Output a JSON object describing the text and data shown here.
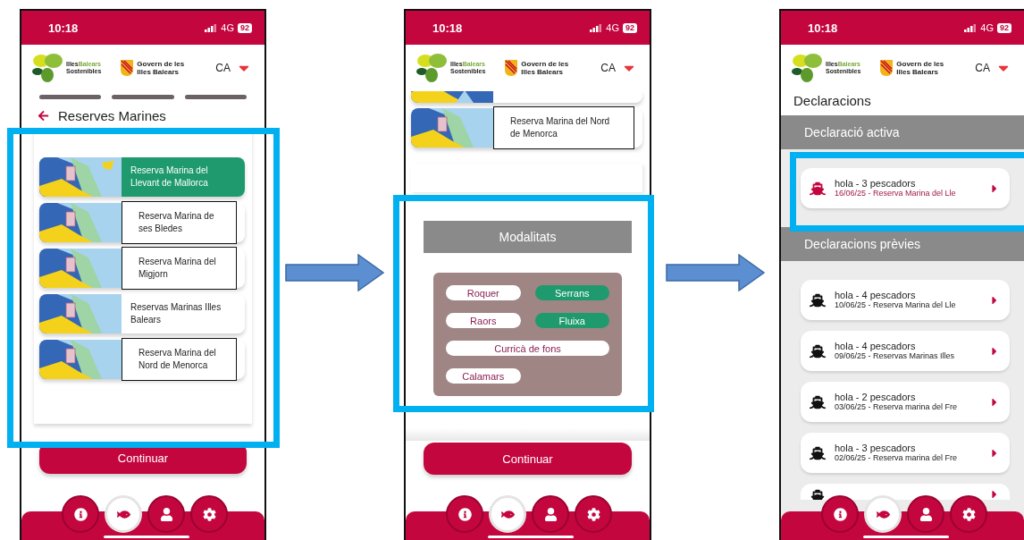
{
  "screens": [
    {
      "kind": "reserves",
      "time": "10:18",
      "network": "4G",
      "battery": "92",
      "brand": [
        "Illes",
        "Balears"
      ],
      "brand_sub": "Sostenibles",
      "govern": [
        "Govern de les",
        "Illes Balears"
      ],
      "language": "CA",
      "progress": [
        {
          "done": false
        },
        {
          "done": false
        },
        {
          "done": false
        }
      ],
      "title": "Reserves Marines",
      "reserves": [
        {
          "name": "Reserva Marina del Llevant de Mallorca",
          "selected": true,
          "outlined": false
        },
        {
          "name": "Reserva Marina de ses Bledes",
          "selected": false,
          "outlined": true
        },
        {
          "name": "Reserva Marina del Migjorn",
          "selected": false,
          "outlined": true
        },
        {
          "name": "Reservas Marinas Illes Balears",
          "selected": false,
          "outlined": false
        },
        {
          "name": "Reserva Marina del Nord de Menorca",
          "selected": false,
          "outlined": true
        }
      ],
      "button": "Continuar",
      "nav": [
        {
          "kind": "info",
          "selected": false
        },
        {
          "kind": "fish",
          "selected": true
        },
        {
          "kind": "user",
          "selected": false
        },
        {
          "kind": "settings",
          "selected": false
        }
      ]
    },
    {
      "kind": "modalitats",
      "time": "10:18",
      "network": "4G",
      "battery": "92",
      "brand": [
        "Illes",
        "Balears"
      ],
      "brand_sub": "Sostenibles",
      "govern": [
        "Govern de les",
        "Illes Balears"
      ],
      "language": "CA",
      "scrolled_card_above": true,
      "reserves": [
        {
          "name": "Reserva Marina del Nord de Menorca",
          "selected": false,
          "outlined": true
        }
      ],
      "blank_card": true,
      "modalitats_title": "Modalitats",
      "chips": [
        {
          "label": "Roquer",
          "selected": false,
          "wide": false
        },
        {
          "label": "Serrans",
          "selected": true,
          "wide": false
        },
        {
          "label": "Raors",
          "selected": false,
          "wide": false
        },
        {
          "label": "Fluixa",
          "selected": true,
          "wide": false
        },
        {
          "label": "Curricà de fons",
          "selected": false,
          "wide": true
        },
        {
          "label": "Calamars",
          "selected": false,
          "wide": false
        }
      ],
      "button": "Continuar",
      "nav": [
        {
          "kind": "info",
          "selected": false
        },
        {
          "kind": "fish",
          "selected": true
        },
        {
          "kind": "user",
          "selected": false
        },
        {
          "kind": "settings",
          "selected": false
        }
      ]
    },
    {
      "kind": "declaracions",
      "time": "10:18",
      "network": "4G",
      "battery": "92",
      "brand": [
        "Illes",
        "Balears"
      ],
      "brand_sub": "Sostenibles",
      "govern": [
        "Govern de les",
        "Illes Balears"
      ],
      "language": "CA",
      "title": "Declaracions",
      "sections": [
        {
          "title": "Declaració activa",
          "more_below": false,
          "items": [
            {
              "title": "hola - 3 pescadors",
              "subtitle": "16/06/25 - Reserva Marina del Lle",
              "active": true
            }
          ]
        },
        {
          "title": "Declaracions prèvies",
          "more_below": true,
          "items": [
            {
              "title": "hola - 4 pescadors",
              "subtitle": "10/06/25 - Reserva Marina del Lle",
              "active": false
            },
            {
              "title": "hola - 4 pescadors",
              "subtitle": "09/06/25 - Reservas Marinas Illes",
              "active": false
            },
            {
              "title": "hola - 2 pescadors",
              "subtitle": "03/06/25 - Reserva marina del Fre",
              "active": false
            },
            {
              "title": "hola - 3 pescadors",
              "subtitle": "02/06/25 - Reserva marina del Fre",
              "active": false
            }
          ]
        }
      ],
      "nav": [
        {
          "kind": "info",
          "selected": false
        },
        {
          "kind": "fish",
          "selected": true
        },
        {
          "kind": "user",
          "selected": false
        },
        {
          "kind": "settings",
          "selected": false
        }
      ]
    }
  ]
}
